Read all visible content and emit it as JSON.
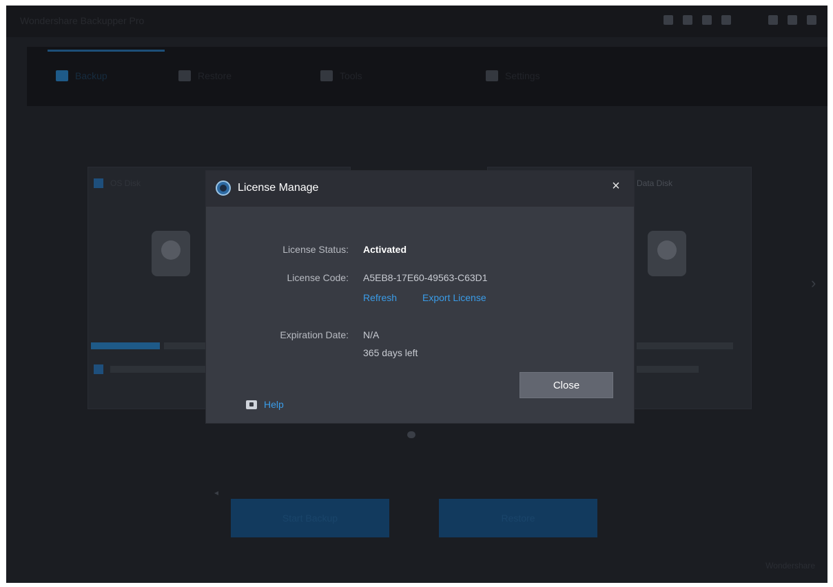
{
  "background": {
    "app_title": "Wondershare Backupper Pro",
    "tabs": [
      "Backup",
      "Restore",
      "Tools",
      "Settings"
    ],
    "cards": [
      {
        "header": "OS Disk"
      },
      {
        "header": "Data Disk"
      }
    ],
    "buttons": [
      "Start Backup",
      "Restore"
    ],
    "footer": "Wondershare"
  },
  "dialog": {
    "title": "License Manage",
    "close_glyph": "×",
    "status_label": "License Status:",
    "status_value": "Activated",
    "code_label": "License Code:",
    "code_value": "A5EB8-17E60-49563-C63D1",
    "refresh_link": "Refresh",
    "export_link": "Export License",
    "expiration_label": "Expiration Date:",
    "expiration_value": "N/A",
    "days_left": "365 days left",
    "close_button": "Close",
    "help_link": "Help"
  },
  "colors": {
    "dialog_bg": "#383b43",
    "dialog_header": "#2c2e35",
    "link": "#3a9ce8",
    "button": "#626670",
    "app_bg": "#1b1d22"
  }
}
